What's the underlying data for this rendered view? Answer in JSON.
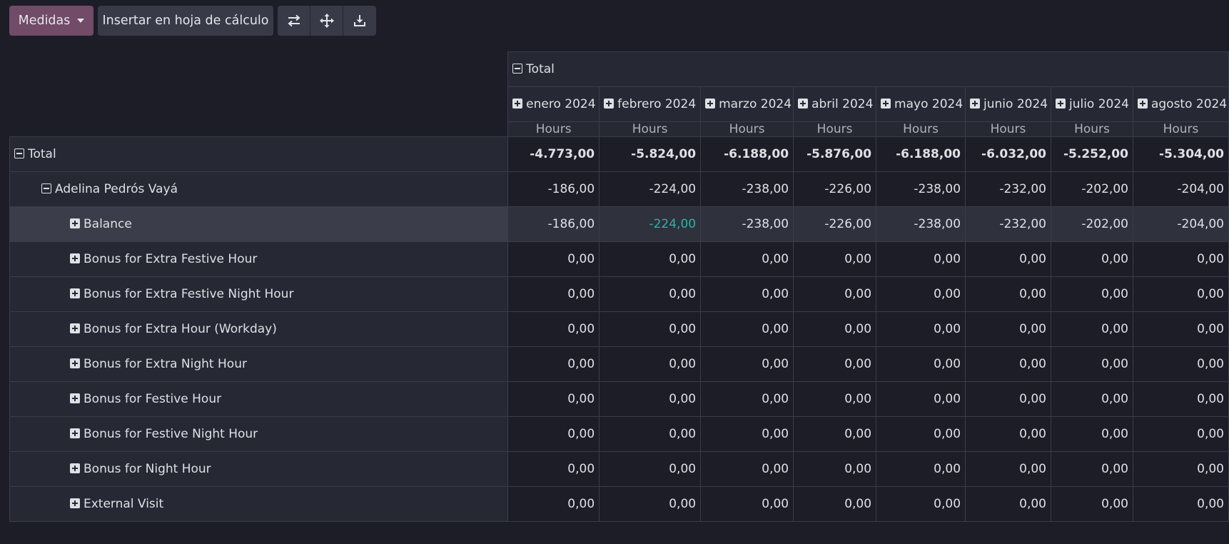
{
  "toolbar": {
    "measures_label": "Medidas",
    "insert_label": "Insertar en hoja de cálculo"
  },
  "icons": [
    "swap-axes-icon",
    "expand-all-icon",
    "download-icon"
  ],
  "pivot": {
    "total_col_label": "Total",
    "columns": [
      "enero 2024",
      "febrero 2024",
      "marzo 2024",
      "abril 2024",
      "mayo 2024",
      "junio 2024",
      "julio 2024",
      "agosto 2024"
    ],
    "measure": "Hours",
    "rows": [
      {
        "label": "Total",
        "toggle": "minus",
        "level": 0,
        "values": [
          "-4.773,00",
          "-5.824,00",
          "-6.188,00",
          "-5.876,00",
          "-6.188,00",
          "-6.032,00",
          "-5.252,00",
          "-5.304,00"
        ]
      },
      {
        "label": "Adelina Pedrós Vayá",
        "toggle": "minus",
        "level": 1,
        "values": [
          "-186,00",
          "-224,00",
          "-238,00",
          "-226,00",
          "-238,00",
          "-232,00",
          "-202,00",
          "-204,00"
        ]
      },
      {
        "label": "Balance",
        "toggle": "plus",
        "level": 2,
        "values": [
          "-186,00",
          "-224,00",
          "-238,00",
          "-226,00",
          "-238,00",
          "-232,00",
          "-202,00",
          "-204,00"
        ]
      },
      {
        "label": "Bonus for Extra Festive Hour",
        "toggle": "plus",
        "level": 2,
        "values": [
          "0,00",
          "0,00",
          "0,00",
          "0,00",
          "0,00",
          "0,00",
          "0,00",
          "0,00"
        ]
      },
      {
        "label": "Bonus for Extra Festive Night Hour",
        "toggle": "plus",
        "level": 2,
        "values": [
          "0,00",
          "0,00",
          "0,00",
          "0,00",
          "0,00",
          "0,00",
          "0,00",
          "0,00"
        ]
      },
      {
        "label": "Bonus for Extra Hour (Workday)",
        "toggle": "plus",
        "level": 2,
        "values": [
          "0,00",
          "0,00",
          "0,00",
          "0,00",
          "0,00",
          "0,00",
          "0,00",
          "0,00"
        ]
      },
      {
        "label": "Bonus for Extra Night Hour",
        "toggle": "plus",
        "level": 2,
        "values": [
          "0,00",
          "0,00",
          "0,00",
          "0,00",
          "0,00",
          "0,00",
          "0,00",
          "0,00"
        ]
      },
      {
        "label": "Bonus for Festive Hour",
        "toggle": "plus",
        "level": 2,
        "values": [
          "0,00",
          "0,00",
          "0,00",
          "0,00",
          "0,00",
          "0,00",
          "0,00",
          "0,00"
        ]
      },
      {
        "label": "Bonus for Festive Night Hour",
        "toggle": "plus",
        "level": 2,
        "values": [
          "0,00",
          "0,00",
          "0,00",
          "0,00",
          "0,00",
          "0,00",
          "0,00",
          "0,00"
        ]
      },
      {
        "label": "Bonus for Night Hour",
        "toggle": "plus",
        "level": 2,
        "values": [
          "0,00",
          "0,00",
          "0,00",
          "0,00",
          "0,00",
          "0,00",
          "0,00",
          "0,00"
        ]
      },
      {
        "label": "External Visit",
        "toggle": "plus",
        "level": 2,
        "values": [
          "0,00",
          "0,00",
          "0,00",
          "0,00",
          "0,00",
          "0,00",
          "0,00",
          "0,00"
        ]
      }
    ],
    "highlighted_row": 2,
    "hovered_cell": {
      "row": 2,
      "col": 1
    },
    "colors": {
      "accent": "#714b67",
      "hover_text": "#26b5a6",
      "background": "#1c1d27"
    }
  }
}
